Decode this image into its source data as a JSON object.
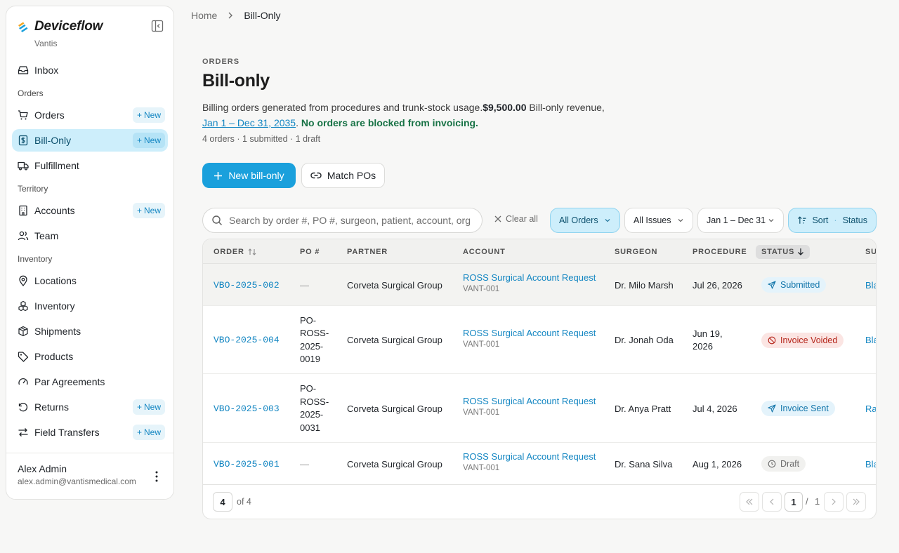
{
  "sidebar": {
    "brand": "Deviceflow",
    "org": "Vantis",
    "sections": {
      "orders": "Orders",
      "territory": "Territory",
      "inventory": "Inventory"
    },
    "items": {
      "inbox": "Inbox",
      "orders": "Orders",
      "bill_only": "Bill-Only",
      "fulfillment": "Fulfillment",
      "accounts": "Accounts",
      "team": "Team",
      "locations": "Locations",
      "inventory": "Inventory",
      "shipments": "Shipments",
      "products": "Products",
      "par_agreements": "Par Agreements",
      "returns": "Returns",
      "field_transfers": "Field Transfers"
    },
    "new_label": "New",
    "user": {
      "name": "Alex Admin",
      "email": "alex.admin@vantismedical.com"
    }
  },
  "breadcrumb": {
    "home": "Home",
    "current": "Bill-Only"
  },
  "header": {
    "eyebrow": "ORDERS",
    "title": "Bill-only",
    "description": "Billing orders generated from procedures and trunk-stock usage.",
    "revenue_amount": "$9,500.00",
    "revenue_label": " Bill-only revenue,",
    "date_range": "Jan 1 – Dec 31, 2035",
    "blocked_note": "No orders are blocked from invoicing.",
    "stats": "4 orders · 1 submitted · 1 draft"
  },
  "actions": {
    "new_bill_only": "New bill-only",
    "match_pos": "Match POs"
  },
  "filters": {
    "search_placeholder": "Search by order #, PO #, surgeon, patient, account, org, or status",
    "clear_all": "Clear all",
    "all_orders": "All Orders",
    "all_issues": "All Issues",
    "date_range": "Jan 1 – Dec 31",
    "sort_label": "Sort",
    "sort_value": "Status"
  },
  "table": {
    "headers": {
      "order": "ORDER",
      "po": "PO #",
      "partner": "PARTNER",
      "account": "ACCOUNT",
      "surgeon": "SURGEON",
      "procedure": "PROCEDURE",
      "status": "STATUS",
      "sales_rep": "SU"
    },
    "rows": [
      {
        "order": "VBO-2025-002",
        "po": "—",
        "partner": "Corveta Surgical Group",
        "account": "ROSS Surgical Account Request",
        "account_code": "VANT-001",
        "surgeon": "Dr. Milo Marsh",
        "procedure": "Jul 26, 2026",
        "status": "Submitted",
        "rep": "Bla"
      },
      {
        "order": "VBO-2025-004",
        "po": "PO-ROSS-2025-0019",
        "partner": "Corveta Surgical Group",
        "account": "ROSS Surgical Account Request",
        "account_code": "VANT-001",
        "surgeon": "Dr. Jonah Oda",
        "procedure": "Jun 19, 2026",
        "status": "Invoice Voided",
        "rep": "Bla"
      },
      {
        "order": "VBO-2025-003",
        "po": "PO-ROSS-2025-0031",
        "partner": "Corveta Surgical Group",
        "account": "ROSS Surgical Account Request",
        "account_code": "VANT-001",
        "surgeon": "Dr. Anya Pratt",
        "procedure": "Jul 4, 2026",
        "status": "Invoice Sent",
        "rep": "Ra"
      },
      {
        "order": "VBO-2025-001",
        "po": "—",
        "partner": "Corveta Surgical Group",
        "account": "ROSS Surgical Account Request",
        "account_code": "VANT-001",
        "surgeon": "Dr. Sana Silva",
        "procedure": "Aug 1, 2026",
        "status": "Draft",
        "rep": "Bla"
      }
    ]
  },
  "pagination": {
    "page_size": "4",
    "of_total": "of 4",
    "current_page": "1",
    "separator": "/",
    "total_pages": "1"
  },
  "colors": {
    "accent": "#1aa0dc",
    "active_nav_bg": "#cdeefb",
    "link": "#1386c2",
    "success": "#177245",
    "danger": "#b42318"
  }
}
